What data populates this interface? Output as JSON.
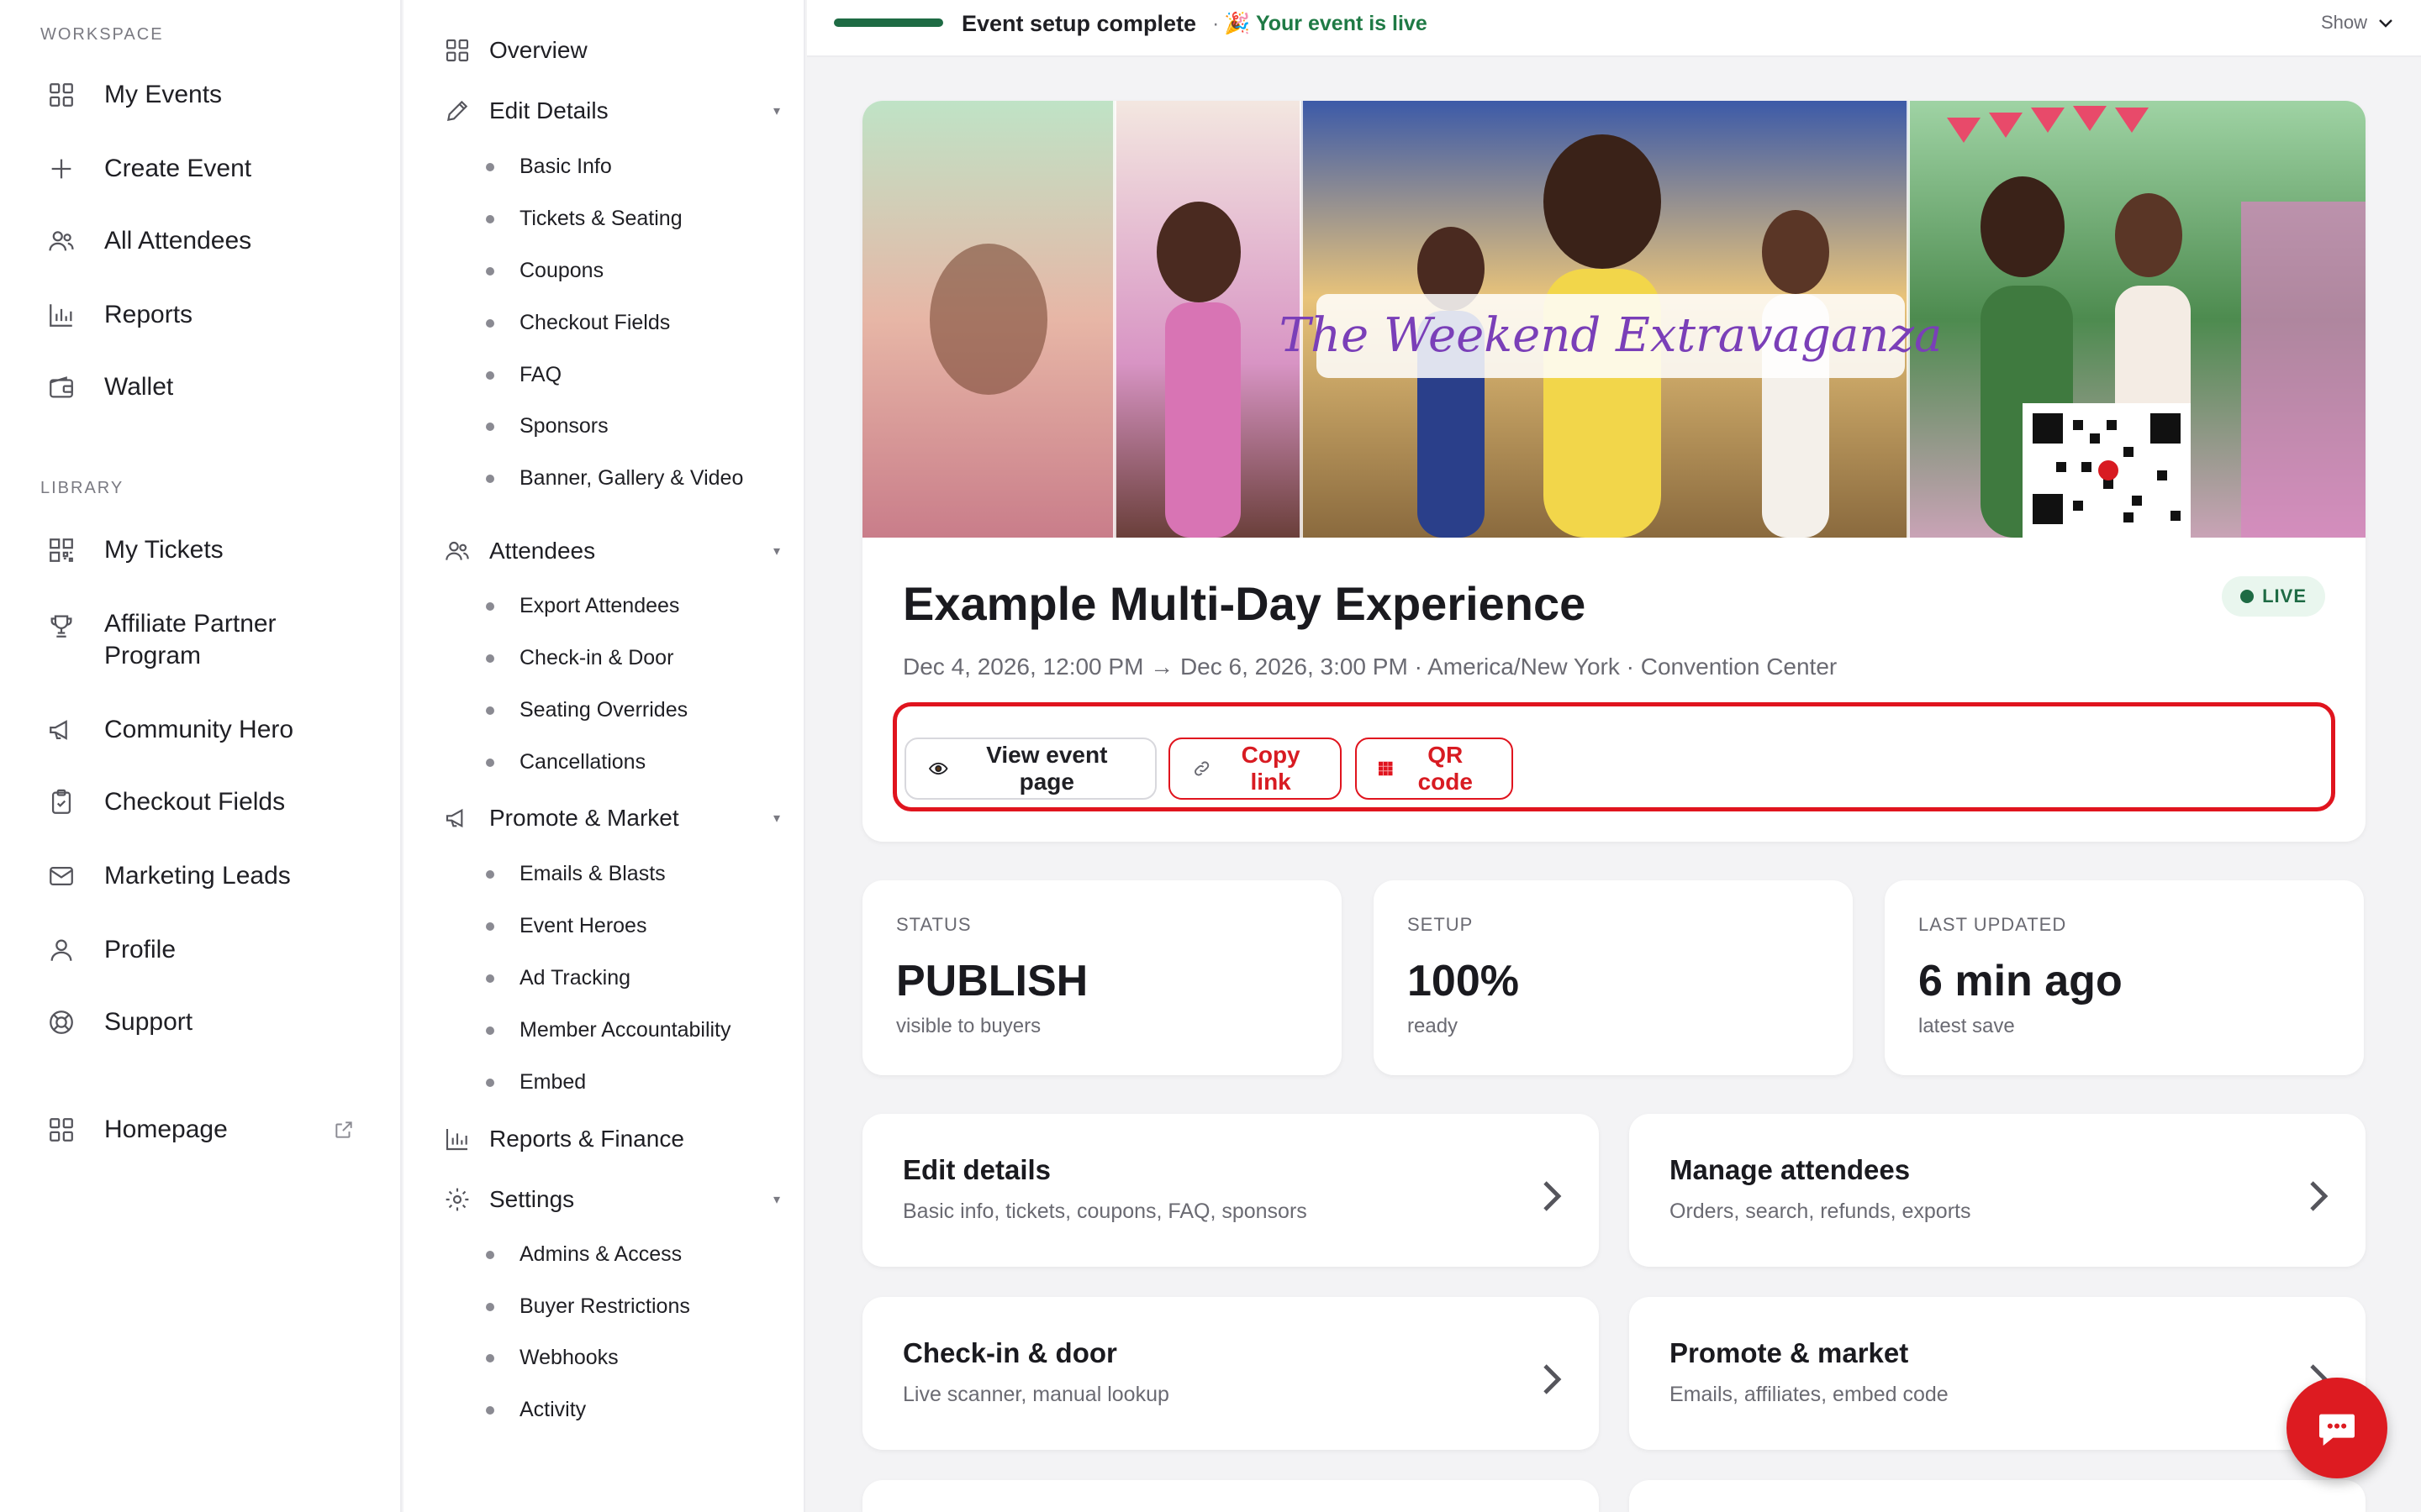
{
  "sidebar": {
    "workspace_label": "WORKSPACE",
    "workspace_items": [
      {
        "label": "My Events",
        "icon": "grid-icon"
      },
      {
        "label": "Create Event",
        "icon": "plus-icon"
      },
      {
        "label": "All Attendees",
        "icon": "users-icon"
      },
      {
        "label": "Reports",
        "icon": "bar-chart-icon"
      },
      {
        "label": "Wallet",
        "icon": "wallet-icon"
      }
    ],
    "library_label": "LIBRARY",
    "library_items": [
      {
        "label": "My Tickets",
        "icon": "qr-icon"
      },
      {
        "label": "Affiliate Partner Program",
        "icon": "trophy-icon"
      },
      {
        "label": "Community Hero",
        "icon": "megaphone-icon"
      },
      {
        "label": "Checkout Fields",
        "icon": "clipboard-icon"
      },
      {
        "label": "Marketing Leads",
        "icon": "mail-icon"
      },
      {
        "label": "Profile",
        "icon": "user-icon"
      },
      {
        "label": "Support",
        "icon": "lifebuoy-icon"
      }
    ],
    "homepage": {
      "label": "Homepage",
      "icon": "grid-icon",
      "external_icon": "external-link-icon"
    }
  },
  "subnav": {
    "overview": "Overview",
    "edit_details": {
      "label": "Edit Details",
      "items": [
        "Basic Info",
        "Tickets & Seating",
        "Coupons",
        "Checkout Fields",
        "FAQ",
        "Sponsors",
        "Banner, Gallery & Video"
      ]
    },
    "attendees": {
      "label": "Attendees",
      "items": [
        "Export Attendees",
        "Check-in & Door",
        "Seating Overrides",
        "Cancellations"
      ]
    },
    "promote": {
      "label": "Promote & Market",
      "items": [
        "Emails & Blasts",
        "Event Heroes",
        "Ad Tracking",
        "Member Accountability",
        "Embed"
      ]
    },
    "reports": "Reports & Finance",
    "settings": {
      "label": "Settings",
      "items": [
        "Admins & Access",
        "Buyer Restrictions",
        "Webhooks",
        "Activity"
      ]
    }
  },
  "topbar": {
    "setup_text": "Event setup complete",
    "separator": "·",
    "live_text": "🎉 Your event is live",
    "show_label": "Show",
    "progress": 1.0
  },
  "event": {
    "banner_title": "The Weekend Extravaganza",
    "title": "Example Multi-Day Experience",
    "meta": "Dec 4, 2026, 12:00 PM → Dec 6, 2026, 3:00 PM · America/New York · Convention Center",
    "badge": "LIVE",
    "buttons": {
      "view": "View event page",
      "copy": "Copy link",
      "qr": "QR code"
    }
  },
  "stats": [
    {
      "label": "STATUS",
      "value": "PUBLISH",
      "sub": "visible to buyers"
    },
    {
      "label": "SETUP",
      "value": "100%",
      "sub": "ready"
    },
    {
      "label": "LAST UPDATED",
      "value": "6 min ago",
      "sub": "latest save"
    }
  ],
  "cards": [
    {
      "title": "Edit details",
      "desc": "Basic info, tickets, coupons, FAQ, sponsors"
    },
    {
      "title": "Manage attendees",
      "desc": "Orders, search, refunds, exports"
    },
    {
      "title": "Check-in & door",
      "desc": "Live scanner, manual lookup"
    },
    {
      "title": "Promote & market",
      "desc": "Emails, affiliates, embed code"
    }
  ],
  "colors": {
    "accent_red": "#e0141e",
    "live_green": "#1e6b44",
    "page_bg": "#f3f3f5"
  }
}
